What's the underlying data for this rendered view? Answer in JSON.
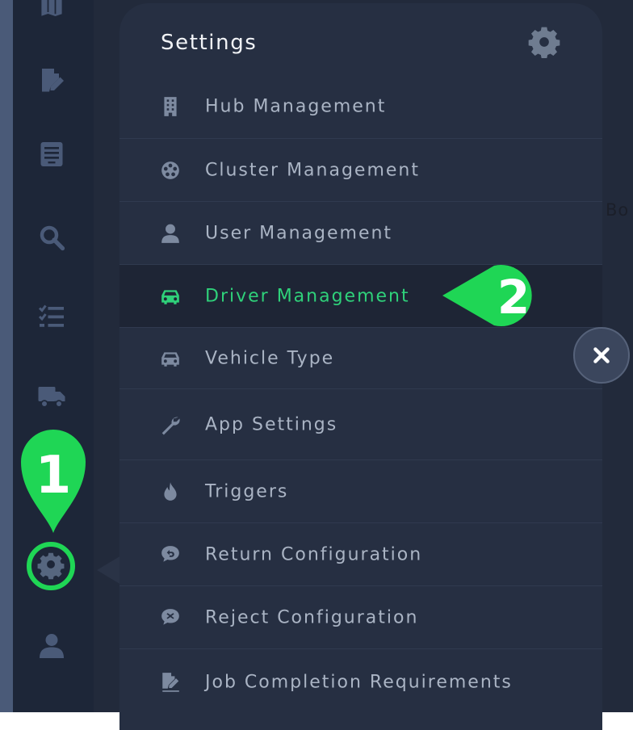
{
  "panel": {
    "title": "Settings",
    "items": [
      {
        "label": "Hub Management",
        "icon": "building-icon"
      },
      {
        "label": "Cluster Management",
        "icon": "cluster-icon"
      },
      {
        "label": "User Management",
        "icon": "user-icon"
      },
      {
        "label": "Driver Management",
        "icon": "car-icon",
        "active": true
      },
      {
        "label": "Vehicle Type",
        "icon": "car-icon"
      },
      {
        "label": "App Settings",
        "icon": "wrench-icon"
      },
      {
        "label": "Triggers",
        "icon": "fire-icon"
      },
      {
        "label": "Return Configuration",
        "icon": "return-chat-icon"
      },
      {
        "label": "Reject Configuration",
        "icon": "reject-chat-icon"
      },
      {
        "label": "Job Completion Requirements",
        "icon": "signature-icon"
      }
    ]
  },
  "callouts": {
    "one": "1",
    "two": "2"
  },
  "background_text": "Bo",
  "colors": {
    "accent": "#1fd655",
    "active_text": "#2fd17a",
    "sidebar": "#1d2638",
    "panel": "#262f42"
  }
}
